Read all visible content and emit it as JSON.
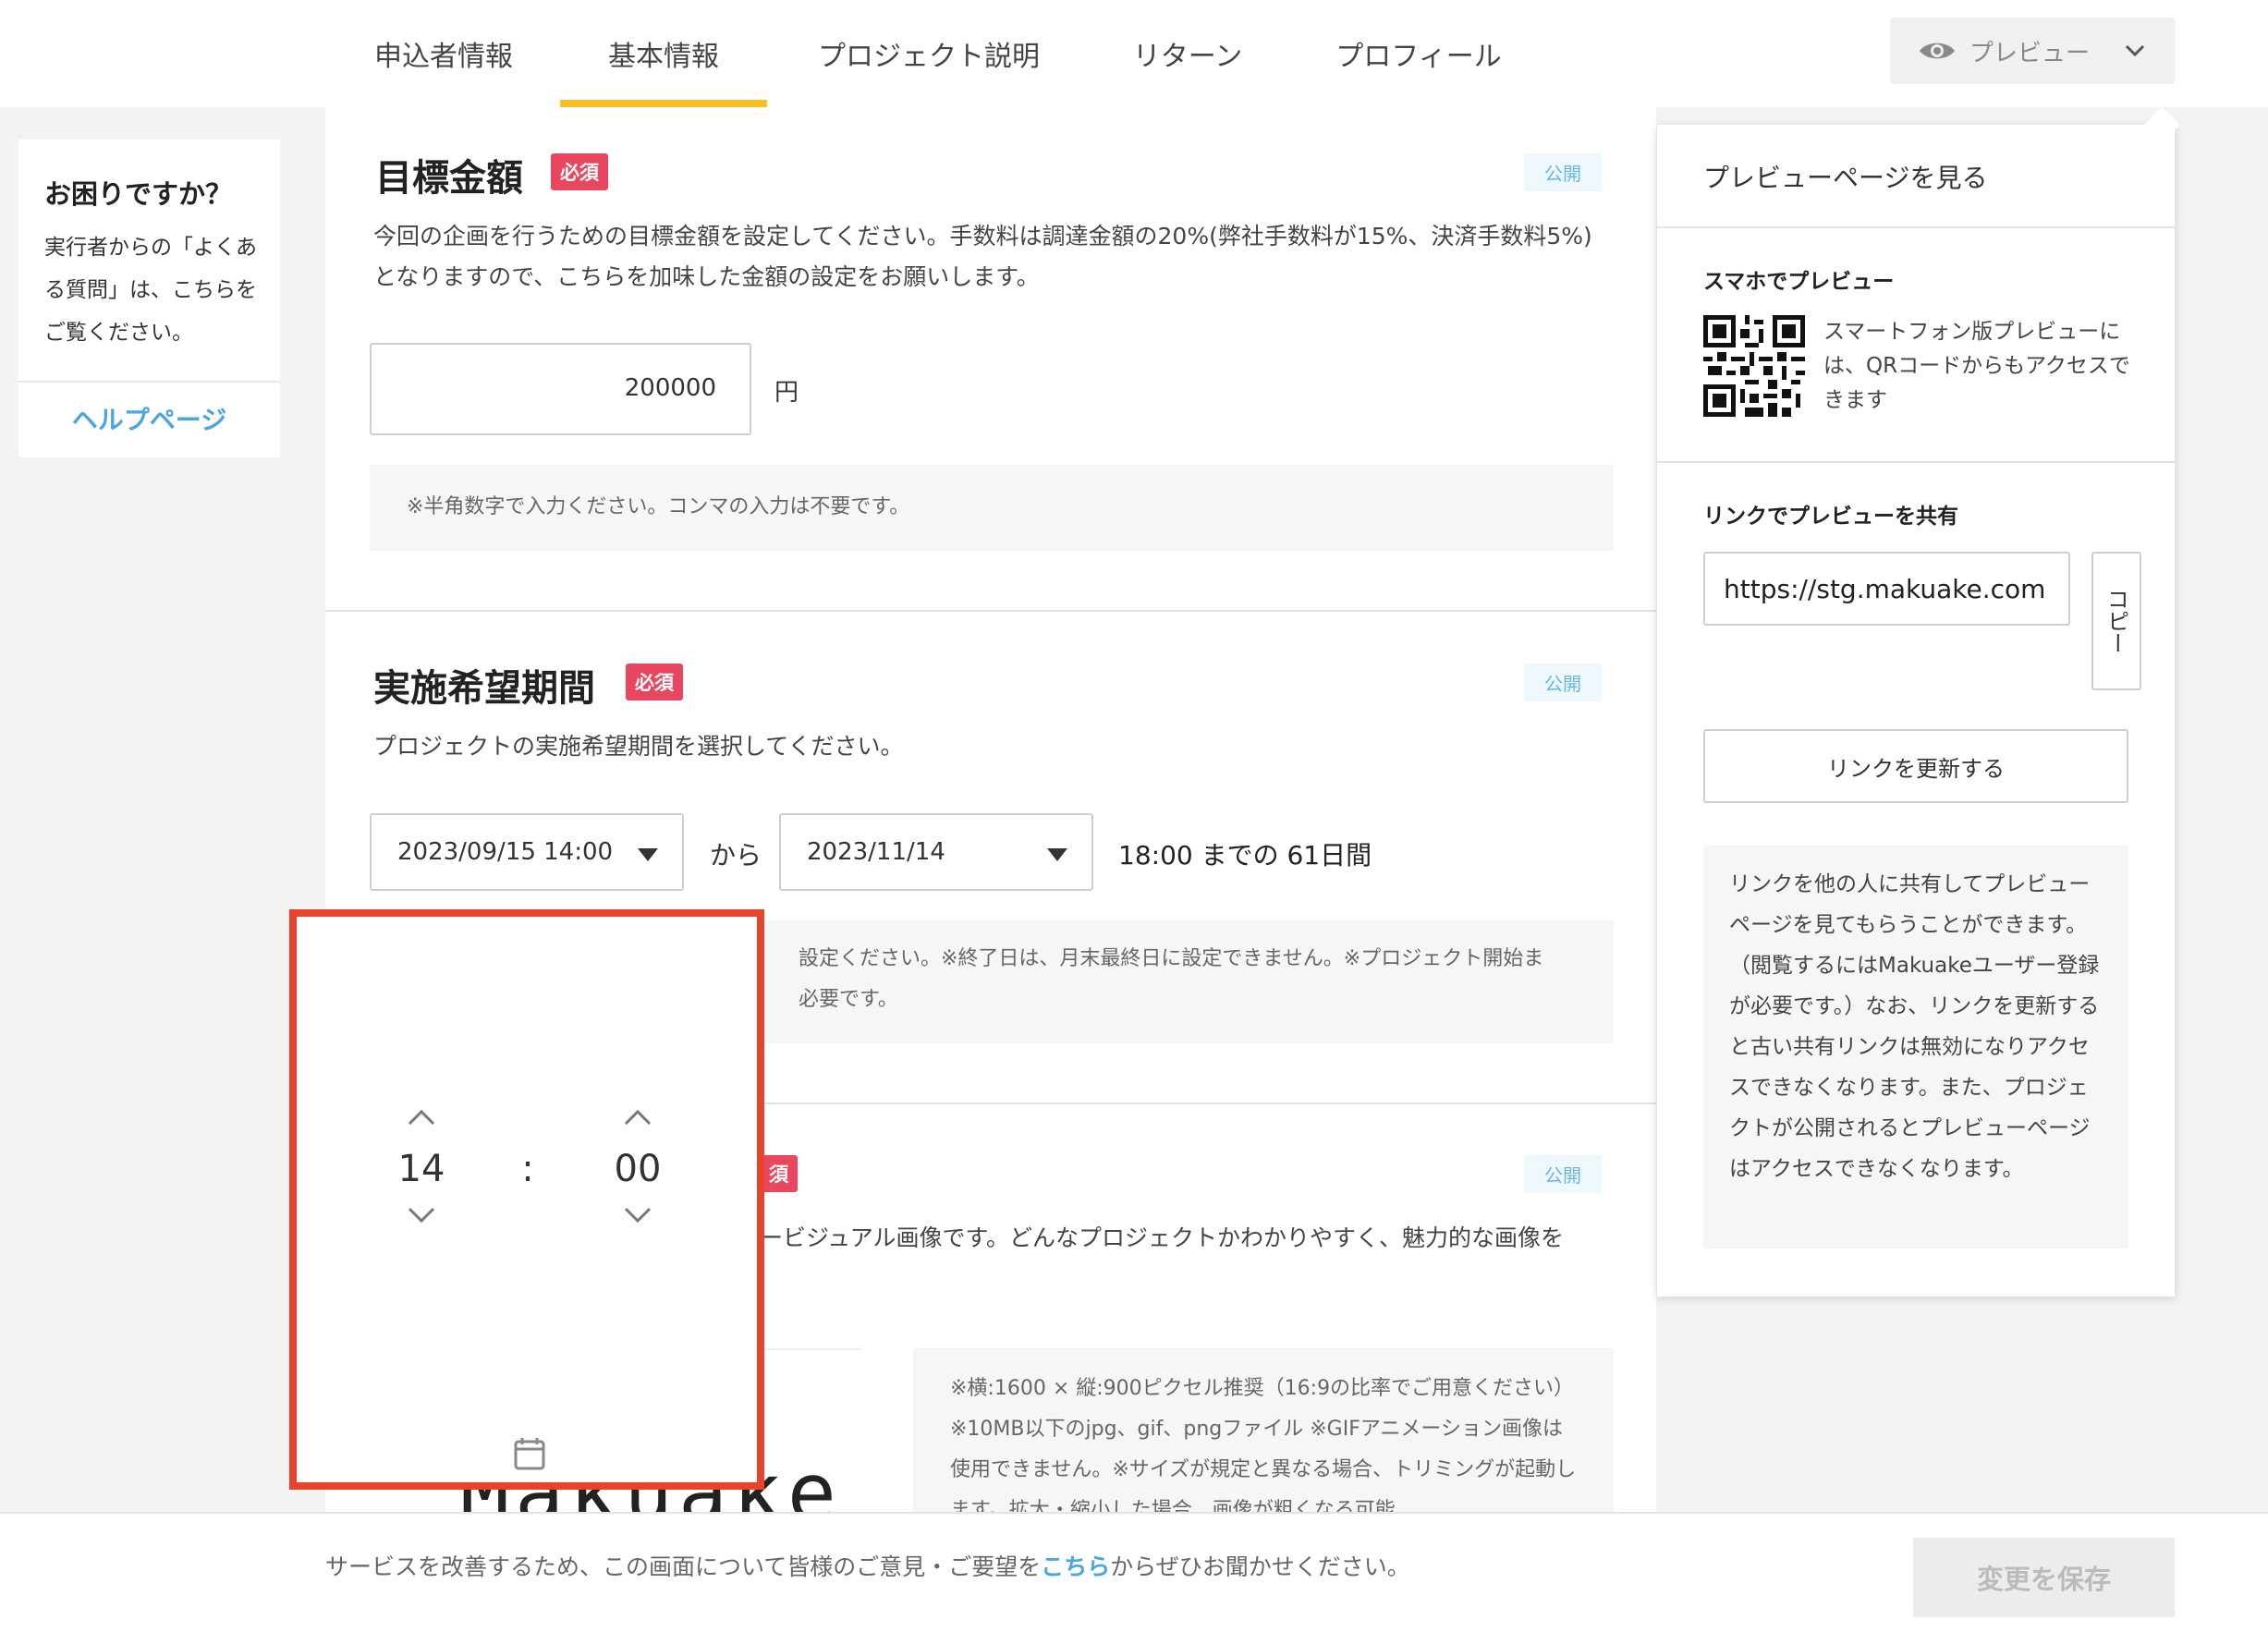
{
  "nav": {
    "tabs": [
      {
        "label": "申込者情報"
      },
      {
        "label": "基本情報"
      },
      {
        "label": "プロジェクト説明"
      },
      {
        "label": "リターン"
      },
      {
        "label": "プロフィール"
      }
    ],
    "active_tab": "基本情報",
    "preview_label": "プレビュー"
  },
  "help": {
    "title": "お困りですか？",
    "body": "実行者からの「よくある質問」は、こちらをご覧ください。",
    "link": "ヘルプページ"
  },
  "sections": {
    "goal": {
      "title": "目標金額",
      "required": "必須",
      "visibility": "公開",
      "description": "今回の企画を行うための目標金額を設定してください。手数料は調達金額の20%(弊社手数料が15%、決済手数料5%)となりますので、こちらを加味した金額の設定をお願いします。",
      "amount_value": "200000",
      "unit": "円",
      "note": "※半角数字で入力ください。コンマの入力は不要です。"
    },
    "period": {
      "title": "実施希望期間",
      "required": "必須",
      "visibility": "公開",
      "description": "プロジェクトの実施希望期間を選択してください。",
      "start_value": "2023/09/15 14:00",
      "from_label": "から",
      "end_value": "2023/11/14",
      "summary": "18:00 までの 61日間",
      "note_line1": "設定ください。※終了日は、月末最終日に設定できません。※プロジェクト開始ま",
      "note_line2": "必要です。"
    },
    "image": {
      "required": "須",
      "visibility": "公開",
      "description": "ービジュアル画像です。どんなプロジェクトかわかりやすく、魅力的な画像を",
      "logo_text": "Makuake",
      "note": "※横:1600 × 縦:900ピクセル推奨（16:9の比率でご用意ください）※10MB以下のjpg、gif、pngファイル ※GIFアニメーション画像は使用できません。※サイズが規定と異なる場合、トリミングが起動します。拡大・縮小した場合、画像が粗くなる可能"
    }
  },
  "time_picker": {
    "hour": "14",
    "minute": "00",
    "separator": ":"
  },
  "preview_panel": {
    "view_page": "プレビューページを見る",
    "smartphone_title": "スマホでプレビュー",
    "smartphone_desc": "スマートフォン版プレビューには、QRコードからもアクセスできます",
    "link_title": "リンクでプレビューを共有",
    "link_value": "https://stg.makuake.com",
    "copy_label": "コピー",
    "refresh_label": "リンクを更新する",
    "info": "リンクを他の人に共有してプレビューページを見てもらうことができます。（閲覧するにはMakuakeユーザー登録が必要です。）なお、リンクを更新すると古い共有リンクは無効になりアクセスできなくなります。また、プロジェクトが公開されるとプレビューページはアクセスできなくなります。"
  },
  "footer": {
    "text_before": "サービスを改善するため、この画面について皆様のご意見・ご要望を",
    "link": "こちら",
    "text_after": "からぜひお聞かせください。",
    "save_label": "変更を保存"
  }
}
